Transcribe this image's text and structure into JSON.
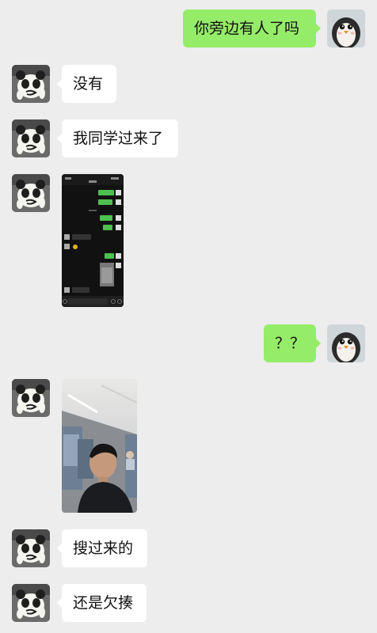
{
  "messages": [
    {
      "id": 1,
      "side": "out",
      "type": "text",
      "text": "你旁边有人了吗"
    },
    {
      "id": 2,
      "side": "in",
      "type": "text",
      "text": "没有"
    },
    {
      "id": 3,
      "side": "in",
      "type": "text",
      "text": "我同学过来了"
    },
    {
      "id": 4,
      "side": "in",
      "type": "image",
      "image_desc": "chat-screenshot"
    },
    {
      "id": 5,
      "side": "out",
      "type": "text",
      "text": "？？"
    },
    {
      "id": 6,
      "side": "in",
      "type": "image",
      "image_desc": "photo-on-train"
    },
    {
      "id": 7,
      "side": "in",
      "type": "text",
      "text": "搜过来的"
    },
    {
      "id": 8,
      "side": "in",
      "type": "text",
      "text": "还是欠揍"
    }
  ],
  "colors": {
    "background": "#ededed",
    "incoming_bubble": "#ffffff",
    "outgoing_bubble": "#95ec69"
  },
  "avatars": {
    "contact": "panda-meme-avatar",
    "self": "penguin-avatar"
  }
}
